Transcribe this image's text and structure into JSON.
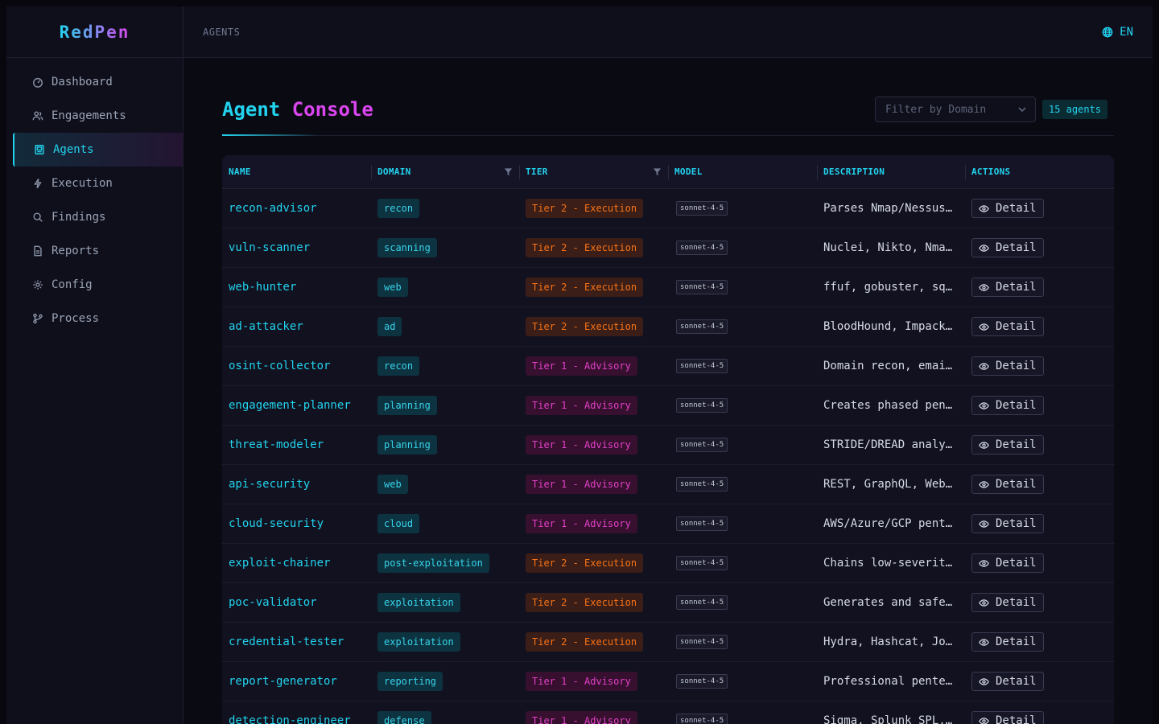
{
  "app": {
    "logo": "RedPen"
  },
  "sidebar": {
    "items": [
      {
        "label": "Dashboard",
        "icon": "gauge-icon"
      },
      {
        "label": "Engagements",
        "icon": "users-icon"
      },
      {
        "label": "Agents",
        "icon": "agent-icon",
        "active": true
      },
      {
        "label": "Execution",
        "icon": "bolt-icon"
      },
      {
        "label": "Findings",
        "icon": "search-icon"
      },
      {
        "label": "Reports",
        "icon": "file-icon"
      },
      {
        "label": "Config",
        "icon": "gear-icon"
      },
      {
        "label": "Process",
        "icon": "branch-icon"
      }
    ]
  },
  "topbar": {
    "breadcrumb": "AGENTS",
    "language": "EN"
  },
  "page": {
    "title_part1": "Agent",
    "title_part2": "Console",
    "filter_placeholder": "Filter by Domain",
    "count_badge": "15 agents"
  },
  "table": {
    "headers": {
      "name": "NAME",
      "domain": "DOMAIN",
      "tier": "TIER",
      "model": "MODEL",
      "description": "DESCRIPTION",
      "actions": "ACTIONS"
    },
    "action_label": "Detail",
    "rows": [
      {
        "name": "recon-advisor",
        "domain": "recon",
        "tier": "Tier 2 - Execution",
        "tier_level": 2,
        "model": "sonnet-4-5",
        "description": "Parses Nmap/Nessus/…"
      },
      {
        "name": "vuln-scanner",
        "domain": "scanning",
        "tier": "Tier 2 - Execution",
        "tier_level": 2,
        "model": "sonnet-4-5",
        "description": "Nuclei, Nikto, Nmap…"
      },
      {
        "name": "web-hunter",
        "domain": "web",
        "tier": "Tier 2 - Execution",
        "tier_level": 2,
        "model": "sonnet-4-5",
        "description": "ffuf, gobuster, sql…"
      },
      {
        "name": "ad-attacker",
        "domain": "ad",
        "tier": "Tier 2 - Execution",
        "tier_level": 2,
        "model": "sonnet-4-5",
        "description": "BloodHound, Impacke…"
      },
      {
        "name": "osint-collector",
        "domain": "recon",
        "tier": "Tier 1 - Advisory",
        "tier_level": 1,
        "model": "sonnet-4-5",
        "description": "Domain recon, email…"
      },
      {
        "name": "engagement-planner",
        "domain": "planning",
        "tier": "Tier 1 - Advisory",
        "tier_level": 1,
        "model": "sonnet-4-5",
        "description": "Creates phased pent…"
      },
      {
        "name": "threat-modeler",
        "domain": "planning",
        "tier": "Tier 1 - Advisory",
        "tier_level": 1,
        "model": "sonnet-4-5",
        "description": "STRIDE/DREAD analys…"
      },
      {
        "name": "api-security",
        "domain": "web",
        "tier": "Tier 1 - Advisory",
        "tier_level": 1,
        "model": "sonnet-4-5",
        "description": "REST, GraphQL, WebS…"
      },
      {
        "name": "cloud-security",
        "domain": "cloud",
        "tier": "Tier 1 - Advisory",
        "tier_level": 1,
        "model": "sonnet-4-5",
        "description": "AWS/Azure/GCP pente…"
      },
      {
        "name": "exploit-chainer",
        "domain": "post-exploitation",
        "tier": "Tier 2 - Execution",
        "tier_level": 2,
        "model": "sonnet-4-5",
        "description": "Chains low-severity…"
      },
      {
        "name": "poc-validator",
        "domain": "exploitation",
        "tier": "Tier 2 - Execution",
        "tier_level": 2,
        "model": "sonnet-4-5",
        "description": "Generates and safel…"
      },
      {
        "name": "credential-tester",
        "domain": "exploitation",
        "tier": "Tier 2 - Execution",
        "tier_level": 2,
        "model": "sonnet-4-5",
        "description": "Hydra, Hashcat, Joh…"
      },
      {
        "name": "report-generator",
        "domain": "reporting",
        "tier": "Tier 1 - Advisory",
        "tier_level": 1,
        "model": "sonnet-4-5",
        "description": "Professional pentes…"
      },
      {
        "name": "detection-engineer",
        "domain": "defense",
        "tier": "Tier 1 - Advisory",
        "tier_level": 1,
        "model": "sonnet-4-5",
        "description": "Sigma, Splunk SPL, …"
      }
    ]
  }
}
